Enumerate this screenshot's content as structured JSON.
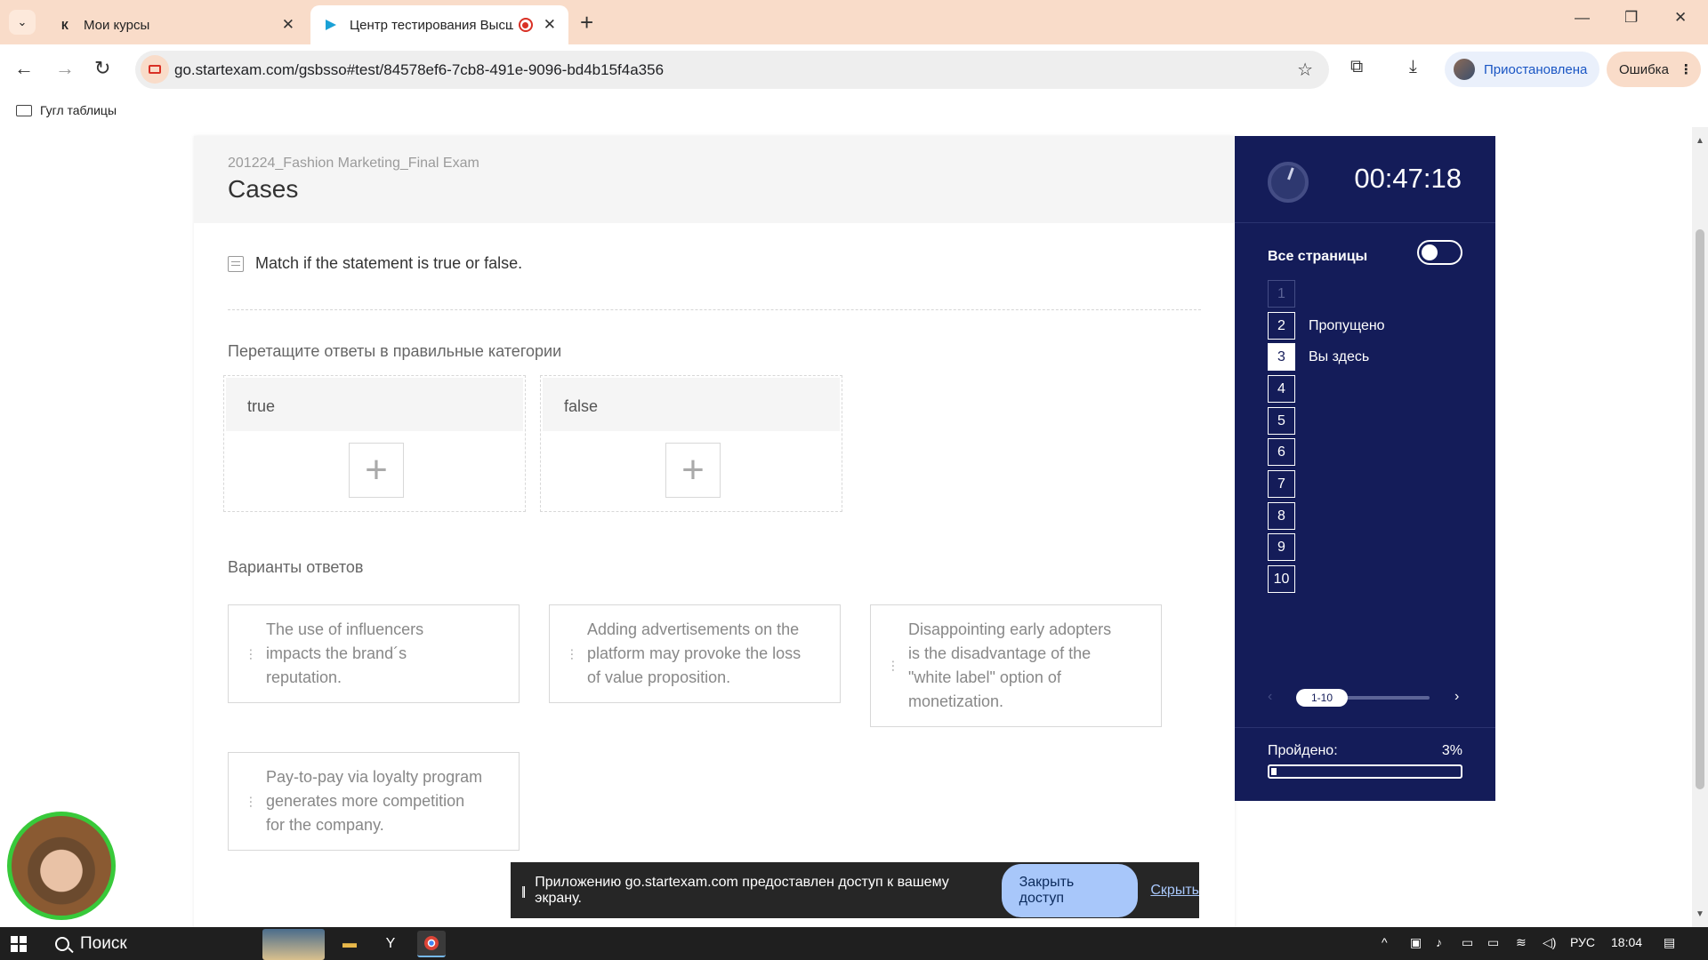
{
  "browser": {
    "tabs": [
      {
        "title": "Мои курсы",
        "favicon": "К"
      },
      {
        "title": "Центр тестирования Высш",
        "favicon": "play-logo"
      }
    ],
    "url": "go.startexam.com/gsbsso#test/84578ef6-7cb8-491e-9096-bd4b15f4a356",
    "profile_label": "Приостановлена",
    "error_label": "Ошибка",
    "bookmark": "Гугл таблицы"
  },
  "exam": {
    "subtitle": "201224_Fashion Marketing_Final Exam",
    "title": "Cases",
    "question": "Match if the statement is true or false.",
    "instruction": "Перетащите ответы в правильные категории",
    "categories": [
      "true",
      "false"
    ],
    "options_label": "Варианты ответов",
    "options": [
      "The use of influencers impacts the brand´s reputation.",
      "Adding advertisements on the platform may provoke the loss of value proposition.",
      "Disappointing early adopters is the disadvantage of the \"white label\" option of monetization.",
      "Pay-to-pay via loyalty program generates more competition for the company."
    ]
  },
  "sidebar": {
    "timer": "00:47:18",
    "all_pages_label": "Все страницы",
    "questions": [
      {
        "num": "1",
        "label": ""
      },
      {
        "num": "2",
        "label": "Пропущено"
      },
      {
        "num": "3",
        "label": "Вы здесь"
      },
      {
        "num": "4",
        "label": ""
      },
      {
        "num": "5",
        "label": ""
      },
      {
        "num": "6",
        "label": ""
      },
      {
        "num": "7",
        "label": ""
      },
      {
        "num": "8",
        "label": ""
      },
      {
        "num": "9",
        "label": ""
      },
      {
        "num": "10",
        "label": ""
      }
    ],
    "page_range": "1-10",
    "progress_label": "Пройдено:",
    "progress_value": "3%",
    "progress_fraction": 0.03,
    "accent_color": "#141c59"
  },
  "share_bar": {
    "message": "Приложению go.startexam.com предоставлен доступ к вашему экрану.",
    "stop_label": "Закрыть доступ",
    "hide_label": "Скрыть"
  },
  "taskbar": {
    "search_label": "Поиск",
    "lang": "РУС",
    "time": "18:04"
  }
}
